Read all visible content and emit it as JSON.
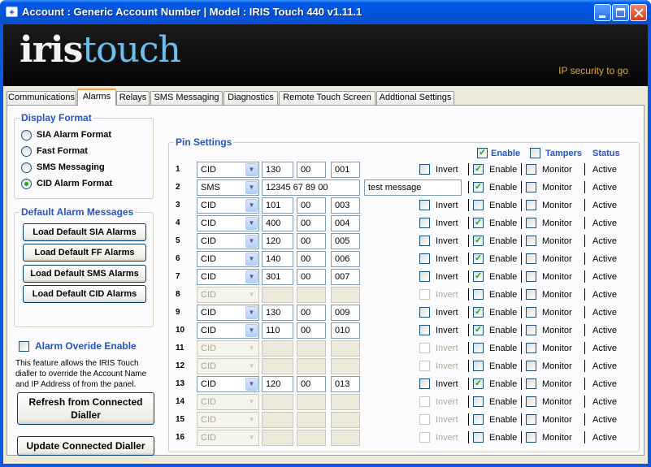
{
  "window": {
    "title": "Account : Generic Account Number  |  Model : IRIS Touch 440 v1.11.1"
  },
  "banner": {
    "logo_part1": "iris",
    "logo_part2": "touch",
    "tagline": "IP security to go"
  },
  "tabs": [
    "Communications",
    "Alarms",
    "Relays",
    "SMS Messaging",
    "Diagnostics",
    "Remote Touch Screen",
    "Addtional Settings"
  ],
  "active_tab": "Alarms",
  "display_format": {
    "title": "Display Format",
    "options": [
      {
        "label": "SIA Alarm Format",
        "selected": false
      },
      {
        "label": "Fast Format",
        "selected": false
      },
      {
        "label": "SMS Messaging",
        "selected": false
      },
      {
        "label": "CID Alarm Format",
        "selected": true
      }
    ]
  },
  "default_messages": {
    "title": "Default Alarm Messages",
    "buttons": [
      "Load Default SIA Alarms",
      "Load Default FF Alarms",
      "Load Default SMS Alarms",
      "Load Default CID Alarms"
    ]
  },
  "override": {
    "label": "Alarm Overide Enable",
    "checked": false,
    "description": "This feature allows the IRIS Touch dialler to override the Account Name and IP Address of from the panel."
  },
  "buttons": {
    "refresh": "Refresh from Connected Dialler",
    "update": "Update Connected Dialler"
  },
  "pin_settings": {
    "title": "Pin Settings",
    "header": {
      "enable_label": "Enable",
      "enable_checked": true,
      "tampers_label": "Tampers",
      "tampers_checked": false,
      "status_label": "Status"
    },
    "invert_label": "Invert",
    "enable_label": "Enable",
    "monitor_label": "Monitor",
    "rows": [
      {
        "num": "1",
        "type": "CID",
        "f1": "130",
        "f2": "00",
        "f3": "001",
        "message": null,
        "active": true,
        "invert": false,
        "enable": true,
        "monitor": false,
        "status": "Active"
      },
      {
        "num": "2",
        "type": "SMS",
        "f1": "12345 67 89 00",
        "f2": null,
        "f3": null,
        "message": "test message",
        "active": true,
        "invert": null,
        "enable": true,
        "monitor": false,
        "status": "Active"
      },
      {
        "num": "3",
        "type": "CID",
        "f1": "101",
        "f2": "00",
        "f3": "003",
        "message": null,
        "active": true,
        "invert": false,
        "enable": false,
        "monitor": false,
        "status": "Active"
      },
      {
        "num": "4",
        "type": "CID",
        "f1": "400",
        "f2": "00",
        "f3": "004",
        "message": null,
        "active": true,
        "invert": false,
        "enable": true,
        "monitor": false,
        "status": "Active"
      },
      {
        "num": "5",
        "type": "CID",
        "f1": "120",
        "f2": "00",
        "f3": "005",
        "message": null,
        "active": true,
        "invert": false,
        "enable": true,
        "monitor": false,
        "status": "Active"
      },
      {
        "num": "6",
        "type": "CID",
        "f1": "140",
        "f2": "00",
        "f3": "006",
        "message": null,
        "active": true,
        "invert": false,
        "enable": true,
        "monitor": false,
        "status": "Active"
      },
      {
        "num": "7",
        "type": "CID",
        "f1": "301",
        "f2": "00",
        "f3": "007",
        "message": null,
        "active": true,
        "invert": false,
        "enable": true,
        "monitor": false,
        "status": "Active"
      },
      {
        "num": "8",
        "type": "CID",
        "f1": "",
        "f2": "",
        "f3": "",
        "message": null,
        "active": false,
        "invert": false,
        "enable": false,
        "monitor": false,
        "status": "Active"
      },
      {
        "num": "9",
        "type": "CID",
        "f1": "130",
        "f2": "00",
        "f3": "009",
        "message": null,
        "active": true,
        "invert": false,
        "enable": true,
        "monitor": false,
        "status": "Active"
      },
      {
        "num": "10",
        "type": "CID",
        "f1": "110",
        "f2": "00",
        "f3": "010",
        "message": null,
        "active": true,
        "invert": false,
        "enable": true,
        "monitor": false,
        "status": "Active"
      },
      {
        "num": "11",
        "type": "CID",
        "f1": "",
        "f2": "",
        "f3": "",
        "message": null,
        "active": false,
        "invert": false,
        "enable": false,
        "monitor": false,
        "status": "Active"
      },
      {
        "num": "12",
        "type": "CID",
        "f1": "",
        "f2": "",
        "f3": "",
        "message": null,
        "active": false,
        "invert": false,
        "enable": false,
        "monitor": false,
        "status": "Active"
      },
      {
        "num": "13",
        "type": "CID",
        "f1": "120",
        "f2": "00",
        "f3": "013",
        "message": null,
        "active": true,
        "invert": false,
        "enable": true,
        "monitor": false,
        "status": "Active"
      },
      {
        "num": "14",
        "type": "CID",
        "f1": "",
        "f2": "",
        "f3": "",
        "message": null,
        "active": false,
        "invert": false,
        "enable": false,
        "monitor": false,
        "status": "Active"
      },
      {
        "num": "15",
        "type": "CID",
        "f1": "",
        "f2": "",
        "f3": "",
        "message": null,
        "active": false,
        "invert": false,
        "enable": false,
        "monitor": false,
        "status": "Active"
      },
      {
        "num": "16",
        "type": "CID",
        "f1": "",
        "f2": "",
        "f3": "",
        "message": null,
        "active": false,
        "invert": false,
        "enable": false,
        "monitor": false,
        "status": "Active"
      }
    ]
  }
}
